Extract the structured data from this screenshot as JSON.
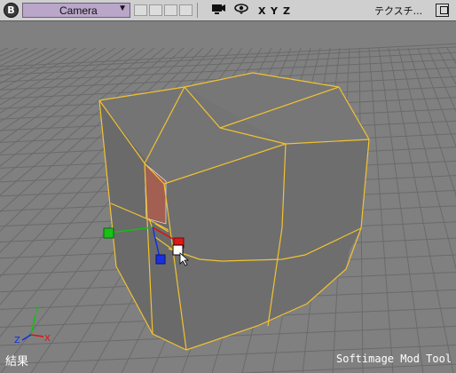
{
  "toolbar": {
    "view_badge": "B",
    "camera_label": "Camera",
    "dropdown_arrow": "▼",
    "axis_x": "X",
    "axis_y": "Y",
    "axis_z": "Z",
    "display_mode": "テクスチ...",
    "icons": [
      "camera-icon",
      "eye-icon",
      "maximize-icon"
    ]
  },
  "viewport": {
    "status_text": "結果",
    "watermark": "Softimage Mod Tool",
    "axis_labels": {
      "x": "X",
      "y": "Y",
      "z": "Z"
    },
    "colors": {
      "background": "#808080",
      "grid": "#6a6a6a",
      "cube_face": "#6f6f6f",
      "edge_highlight": "#f2c230",
      "selected_polygon": "#a35f50",
      "axis_x": "#e01010",
      "axis_y": "#10c010",
      "axis_z": "#1030e0"
    }
  }
}
